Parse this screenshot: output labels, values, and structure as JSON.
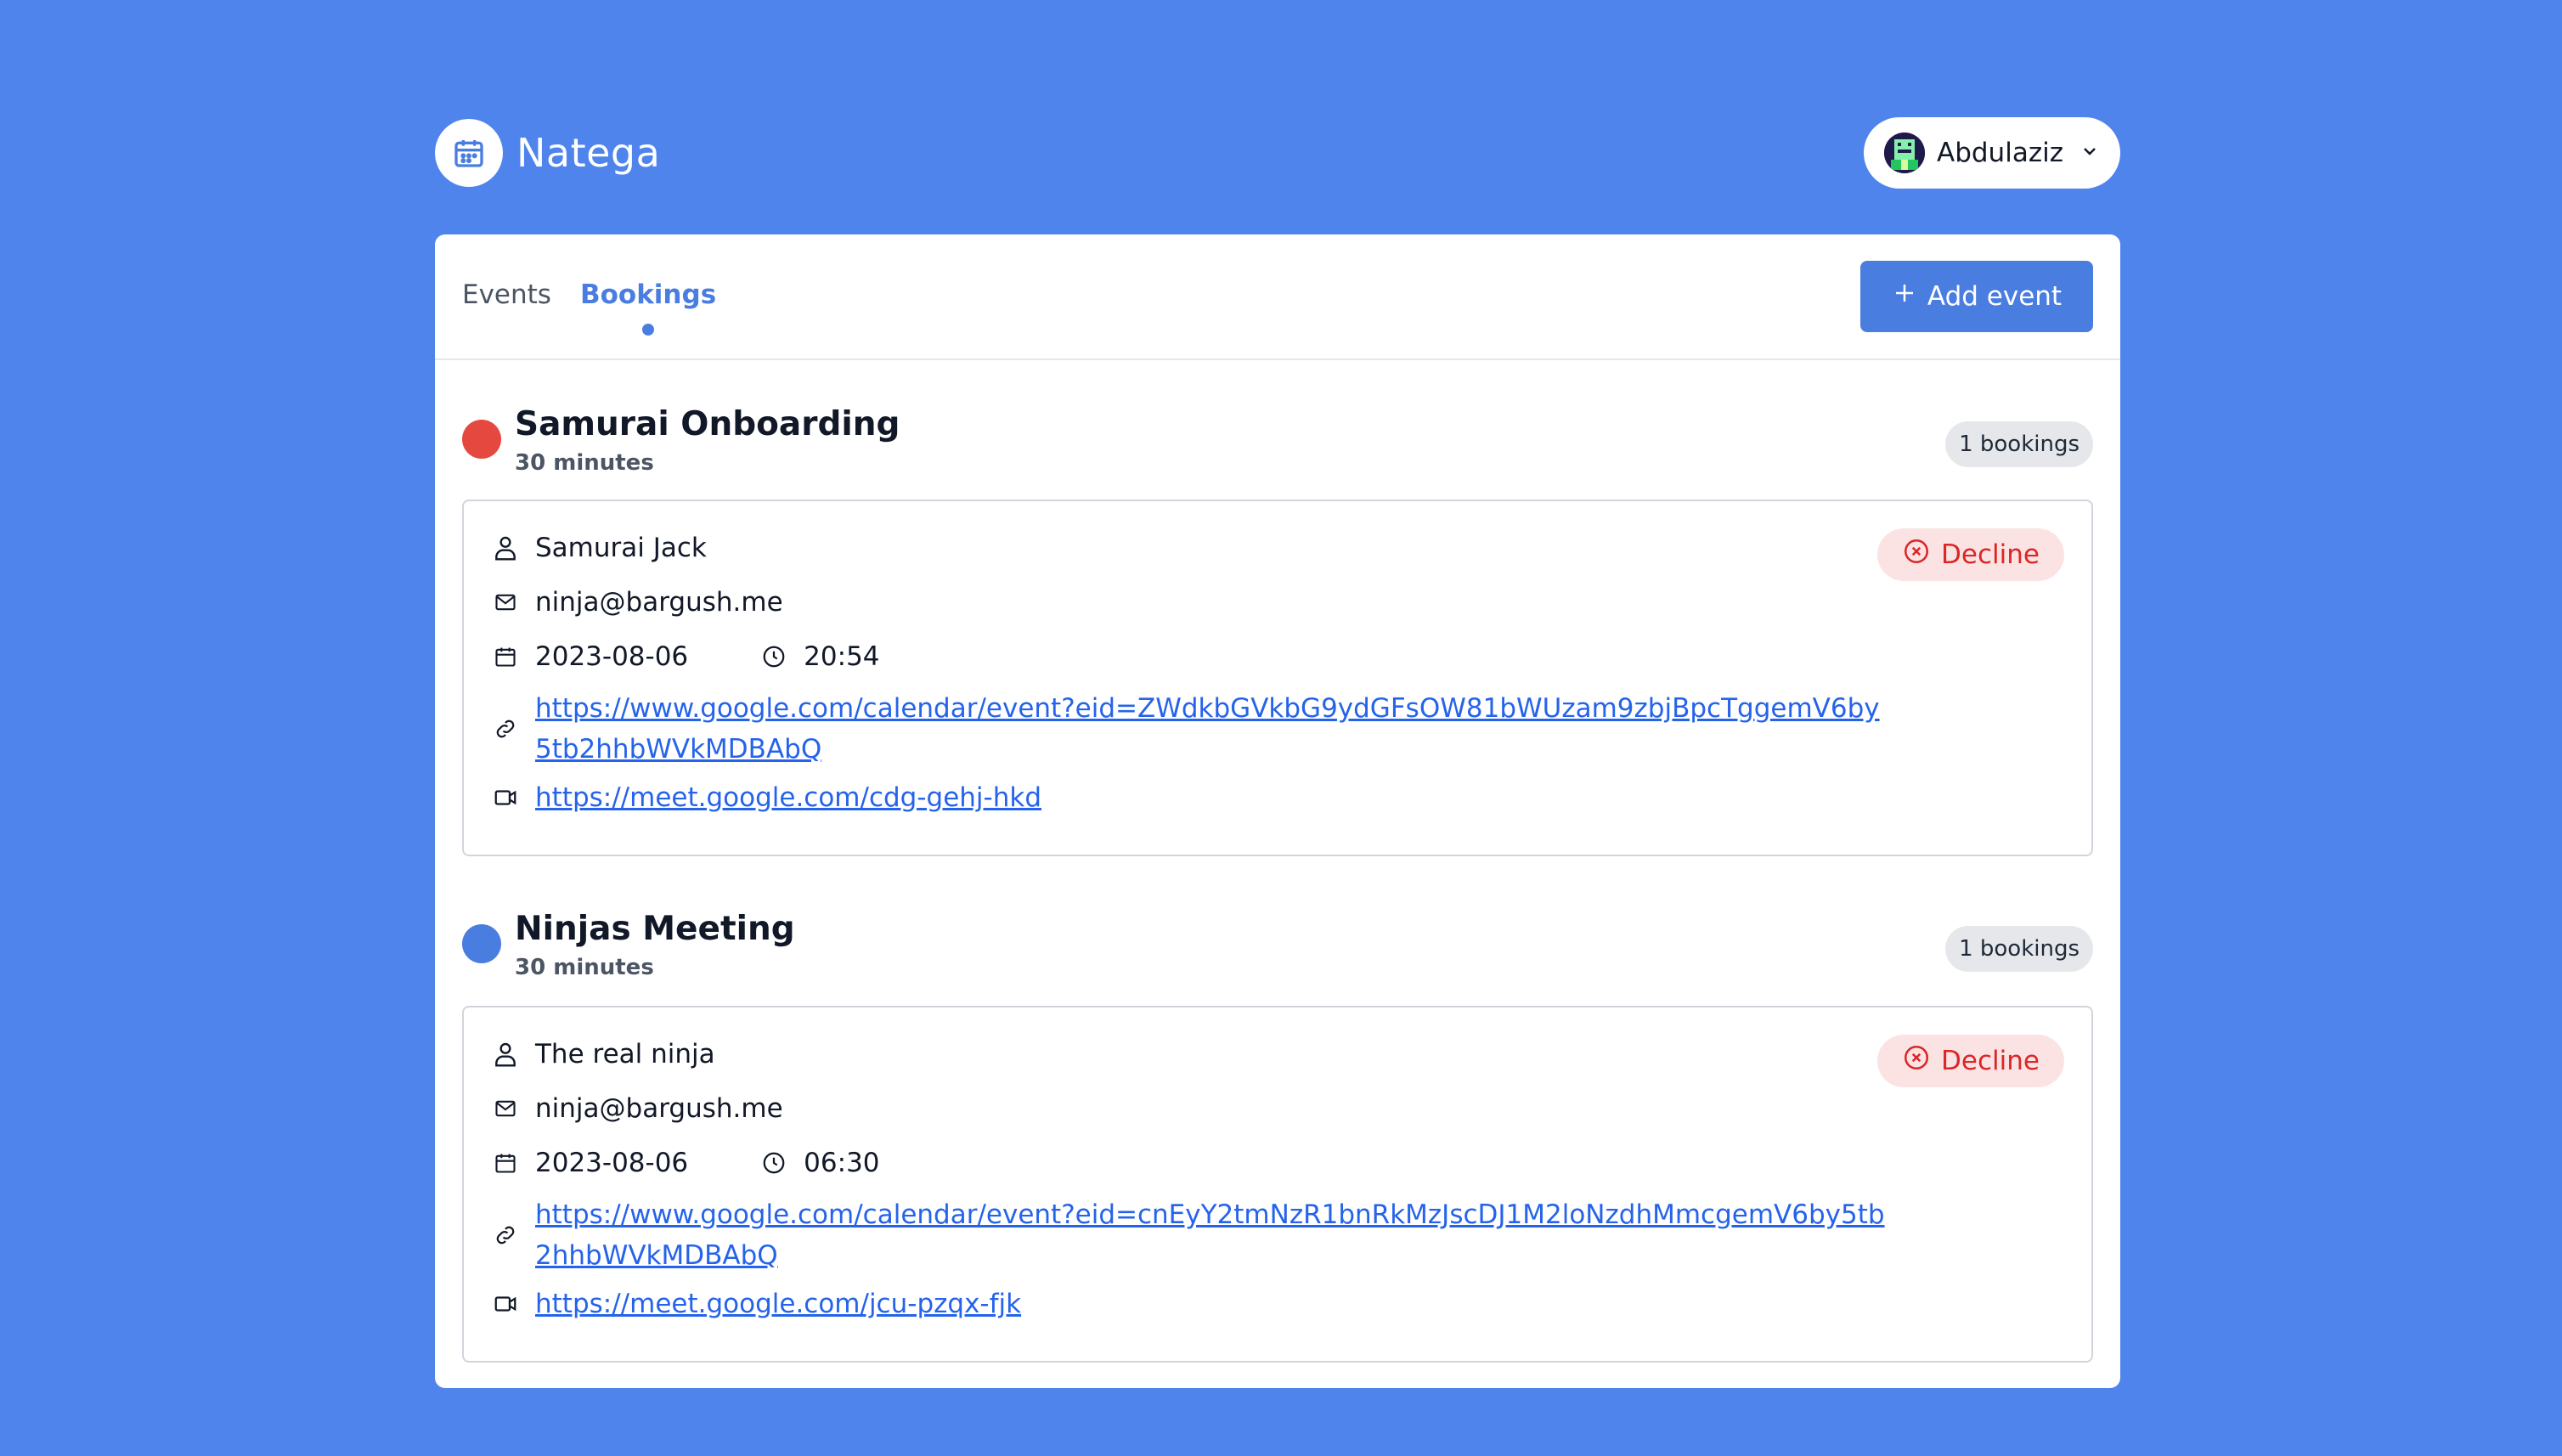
{
  "brand": {
    "name": "Natega",
    "icon": "calendar-icon"
  },
  "user": {
    "name": "Abdulaziz"
  },
  "tabs": [
    {
      "label": "Events",
      "active": false
    },
    {
      "label": "Bookings",
      "active": true
    }
  ],
  "actions": {
    "add_event": "Add event"
  },
  "events": [
    {
      "title": "Samurai Onboarding",
      "duration": "30 minutes",
      "color": "#e5483f",
      "badge": "1 bookings",
      "booking": {
        "name": "Samurai Jack",
        "email": "ninja@bargush.me",
        "date": "2023-08-06",
        "time": "20:54",
        "calendar_link": "https://www.google.com/calendar/event?eid=ZWdkbGVkbG9ydGFsOW81bWUzam9zbjBpcTggemV6by5tb2hhbWVkMDBAbQ",
        "meet_link": "https://meet.google.com/cdg-gehj-hkd",
        "decline_label": "Decline"
      }
    },
    {
      "title": "Ninjas Meeting",
      "duration": "30 minutes",
      "color": "#4a7de0",
      "badge": "1 bookings",
      "booking": {
        "name": "The real ninja",
        "email": "ninja@bargush.me",
        "date": "2023-08-06",
        "time": "06:30",
        "calendar_link": "https://www.google.com/calendar/event?eid=cnEyY2tmNzR1bnRkMzJscDJ1M2loNzdhMmcgemV6by5tb2hhbWVkMDBAbQ",
        "meet_link": "https://meet.google.com/jcu-pzqx-fjk",
        "decline_label": "Decline"
      }
    }
  ],
  "colors": {
    "background": "#4f84ed",
    "accent": "#4a7de0",
    "danger": "#dc2626"
  }
}
